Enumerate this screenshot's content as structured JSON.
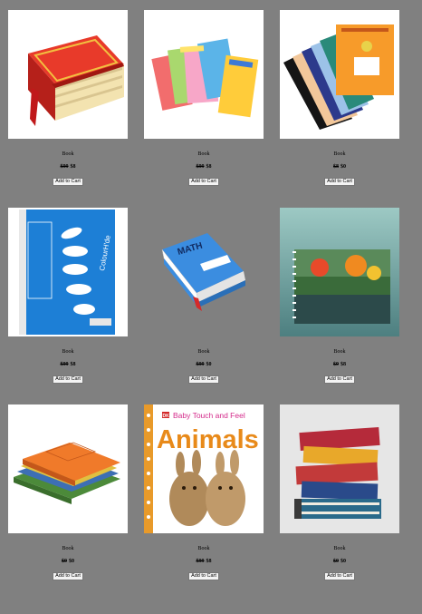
{
  "products": [
    {
      "name": "Book",
      "old_price": "$99",
      "price": "$8",
      "button": "Add to Cart",
      "image": "red-hardcover-book-icon"
    },
    {
      "name": "Book",
      "old_price": "$99",
      "price": "$8",
      "button": "Add to Cart",
      "image": "spiral-notebooks-icon"
    },
    {
      "name": "Book",
      "old_price": "$8",
      "price": "$0",
      "button": "Add to Cart",
      "image": "school-notebooks-icon"
    },
    {
      "name": "Book",
      "old_price": "$99",
      "price": "$8",
      "button": "Add to Cart",
      "image": "blue-spiral-notebook-icon",
      "notebook_brand": "ColourH'de"
    },
    {
      "name": "Book",
      "old_price": "$99",
      "price": "$0",
      "button": "Add to Cart",
      "image": "math-book-icon",
      "book_title": "MATH"
    },
    {
      "name": "Book",
      "old_price": "$9",
      "price": "$8",
      "button": "Add to Cart",
      "image": "sketch-book-icon"
    },
    {
      "name": "Book",
      "old_price": "$9",
      "price": "$0",
      "button": "Add to Cart",
      "image": "stacked-exercise-books-icon"
    },
    {
      "name": "Book",
      "old_price": "$99",
      "price": "$8",
      "button": "Add to Cart",
      "image": "animals-board-book-icon",
      "cover_brand": "DK",
      "cover_subtitle": "Baby Touch and Feel",
      "cover_title": "Animals"
    },
    {
      "name": "Book",
      "old_price": "$9",
      "price": "$0",
      "button": "Add to Cart",
      "image": "book-stack-icon"
    }
  ]
}
